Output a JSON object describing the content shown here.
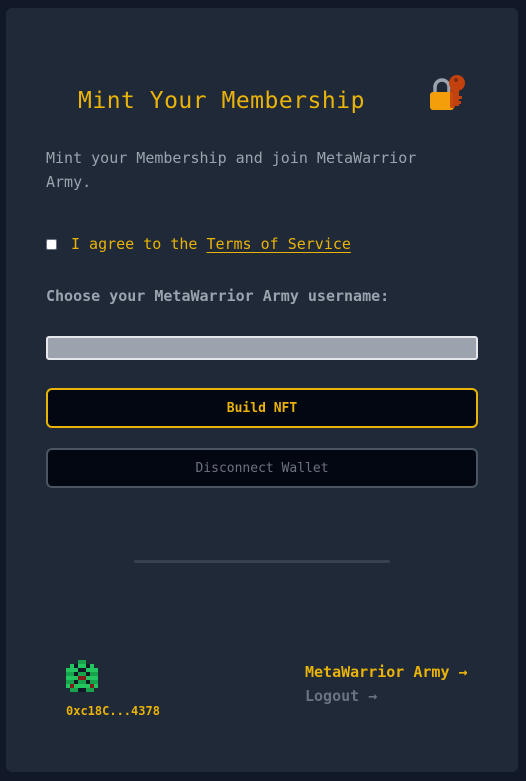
{
  "card": {
    "title": "Mint Your Membership",
    "title_icon": "lock-with-key-icon",
    "description": "Mint your Membership and join MetaWarrior Army.",
    "agree": {
      "checked": false,
      "prefix": "I agree to the",
      "link_text": "Terms of Service"
    },
    "username_label": "Choose your MetaWarrior Army username:",
    "username_value": "",
    "build_button": "Build NFT",
    "disconnect_button": "Disconnect Wallet"
  },
  "footer": {
    "avatar_icon": "pixel-warrior-avatar-icon",
    "address": "0xc18C...4378",
    "army_link": "MetaWarrior Army →",
    "logout_link": "Logout →"
  },
  "colors": {
    "accent": "#eab308",
    "background": "#111827",
    "card": "#1f2937",
    "muted": "#9ca3af",
    "button_bg": "#030712"
  }
}
